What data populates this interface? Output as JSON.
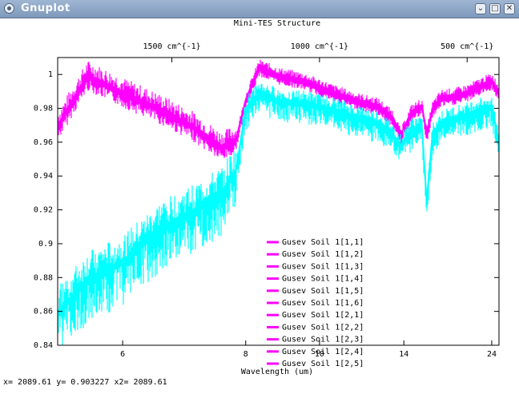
{
  "window": {
    "title": "Gnuplot",
    "buttons": {
      "minimize": "⌄",
      "maximize": "□",
      "close": "✕"
    }
  },
  "status": {
    "text": "x= 2089.61 y= 0.903227 x2= 2089.61"
  },
  "colors": {
    "magenta": "#ff00ff",
    "cyan": "#00ffff"
  },
  "chart_data": {
    "type": "line",
    "title": "Mini-TES Structure",
    "xlabel": "Wavelength (um)",
    "ylabel": "",
    "ylim": [
      0.84,
      1.01
    ],
    "xlim": [
      5.3,
      25.5
    ],
    "x_scale": "reciprocal",
    "x_ticks": [
      "6",
      "8",
      "10",
      "14",
      "24"
    ],
    "x_tick_values": [
      6,
      8,
      10,
      14,
      24
    ],
    "y_ticks": [
      "0.84",
      "0.86",
      "0.88",
      "0.9",
      "0.92",
      "0.94",
      "0.96",
      "0.98",
      "1"
    ],
    "y_tick_values": [
      0.84,
      0.86,
      0.88,
      0.9,
      0.92,
      0.94,
      0.96,
      0.98,
      1.0
    ],
    "x2_ticks": [
      "1500 cm^{-1}",
      "1000 cm^{-1}",
      "500 cm^{-1}"
    ],
    "x2_tick_values": [
      1500,
      1000,
      500
    ],
    "legend_position": "bottom-center",
    "legend": [
      "Gusev Soil 1[1,1]",
      "Gusev Soil 1[1,2]",
      "Gusev Soil 1[1,3]",
      "Gusev Soil 1[1,4]",
      "Gusev Soil 1[1,5]",
      "Gusev Soil 1[1,6]",
      "Gusev Soil 1[2,1]",
      "Gusev Soil 1[2,2]",
      "Gusev Soil 1[2,3]",
      "Gusev Soil 1[2,4]",
      "Gusev Soil 1[2,5]"
    ],
    "series": [
      {
        "name": "Gusev Soil 1[1,1]",
        "color": "#ff00ff",
        "x": [
          5.3,
          5.6,
          6.0,
          6.5,
          7.0,
          7.5,
          7.8,
          8.0,
          8.3,
          8.8,
          9.5,
          10.5,
          11.5,
          12.5,
          13.3,
          13.8,
          14.5,
          15.3,
          15.7,
          16.2,
          17.0,
          18.5,
          20.0,
          22.0,
          24.0,
          25.5
        ],
        "y": [
          0.97,
          1.0,
          0.99,
          0.98,
          0.97,
          0.958,
          0.962,
          0.985,
          1.005,
          1.0,
          0.997,
          0.99,
          0.985,
          0.982,
          0.975,
          0.964,
          0.978,
          0.982,
          0.965,
          0.98,
          0.987,
          0.988,
          0.99,
          0.994,
          0.997,
          0.99
        ]
      },
      {
        "name": "Gusev Soil 1[2,5]",
        "color": "#00ffff",
        "x": [
          5.3,
          5.6,
          6.0,
          6.5,
          7.0,
          7.5,
          7.8,
          8.0,
          8.3,
          8.8,
          9.5,
          10.5,
          11.5,
          12.5,
          13.3,
          13.8,
          14.5,
          15.3,
          15.7,
          16.2,
          17.0,
          18.5,
          20.0,
          22.0,
          24.0,
          25.5
        ],
        "y": [
          0.86,
          0.88,
          0.89,
          0.91,
          0.92,
          0.93,
          0.944,
          0.98,
          0.99,
          0.985,
          0.984,
          0.98,
          0.975,
          0.972,
          0.965,
          0.958,
          0.968,
          0.97,
          0.925,
          0.965,
          0.972,
          0.975,
          0.977,
          0.98,
          0.982,
          0.96
        ]
      }
    ]
  }
}
